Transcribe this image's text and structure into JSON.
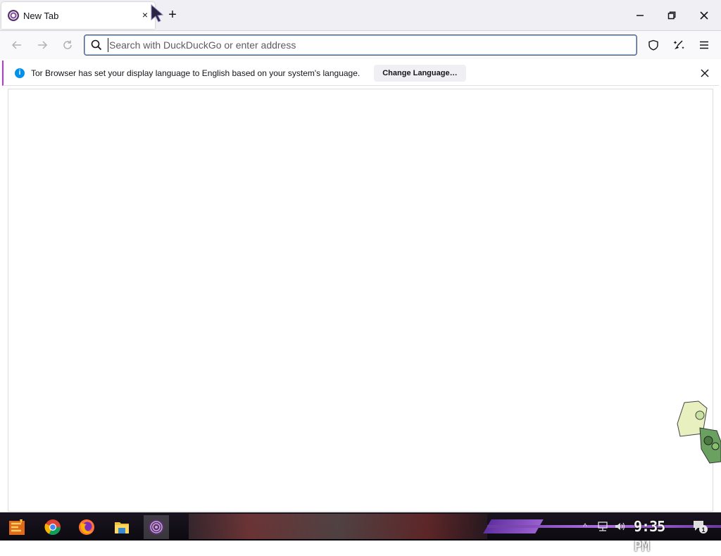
{
  "tab": {
    "title": "New Tab",
    "close": "×"
  },
  "newtab": "+",
  "urlbar": {
    "placeholder": "Search with DuckDuckGo or enter address"
  },
  "notification": {
    "message": "Tor Browser has set your display language to English based on your system's language.",
    "button": "Change Language…",
    "info_glyph": "i"
  },
  "taskbar": {
    "apps": [
      "start-menu",
      "chrome",
      "firefox",
      "file-explorer",
      "tor-browser"
    ],
    "active_app": "tor-browser",
    "clock": "9:35 PM",
    "notification_count": "1",
    "tray_chevron": "^"
  },
  "colors": {
    "accent": "#0090ed",
    "tor_purple": "#7d4698",
    "notif_border": "#b833e1"
  }
}
